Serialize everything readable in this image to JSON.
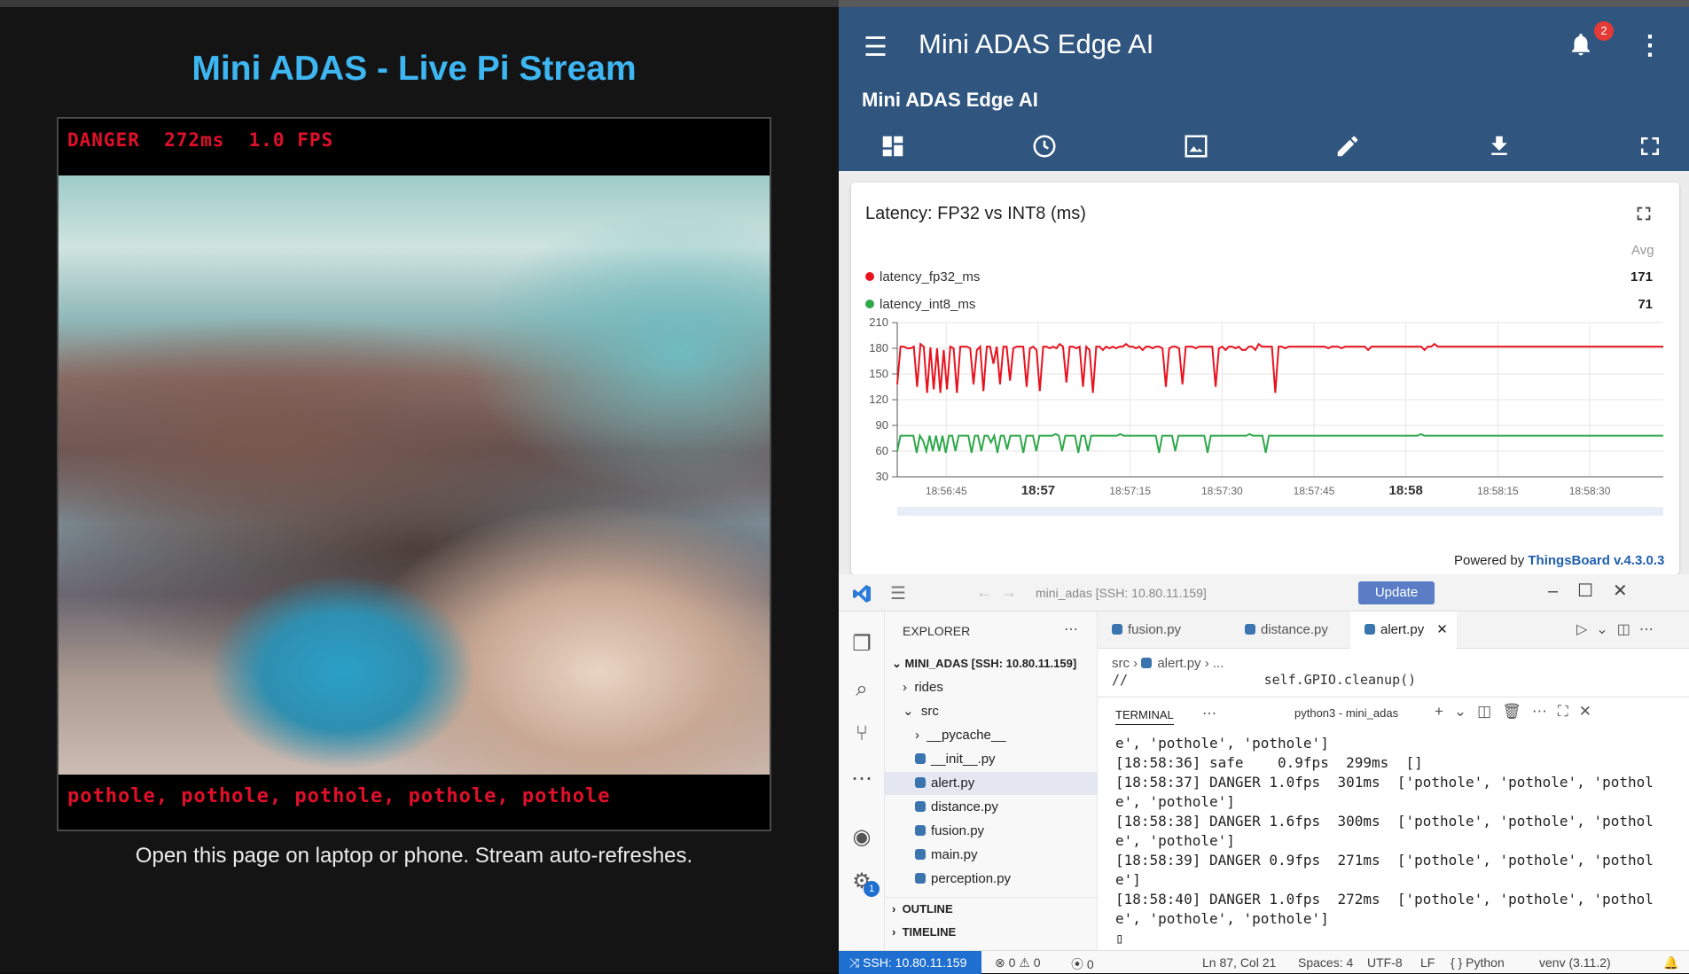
{
  "stream": {
    "title": "Mini ADAS - Live Pi Stream",
    "overlay_status": "DANGER  272ms  1.0 FPS",
    "overlay_labels": "pothole, pothole, pothole, pothole, pothole",
    "caption": "Open this page on laptop or phone. Stream auto-refreshes."
  },
  "thingsboard": {
    "app_title": "Mini ADAS Edge AI",
    "notification_count": "2",
    "dashboard_title": "Mini ADAS Edge AI",
    "toolbar_icons": [
      "dashboard-icon",
      "clock-icon",
      "image-icon",
      "edit-icon",
      "download-icon",
      "fullscreen-icon"
    ],
    "widget": {
      "title": "Latency: FP32 vs INT8 (ms)",
      "avg_label": "Avg",
      "legend": [
        {
          "name": "latency_fp32_ms",
          "avg": "171",
          "color": "#e8131f"
        },
        {
          "name": "latency_int8_ms",
          "avg": "71",
          "color": "#2fa84a"
        }
      ],
      "powered_prefix": "Powered by",
      "powered_link": "ThingsBoard v.4.3.0.3"
    }
  },
  "chart_data": {
    "type": "line",
    "title": "Latency: FP32 vs INT8 (ms)",
    "xlabel": "",
    "ylabel": "",
    "ylim": [
      30,
      210
    ],
    "yticks": [
      30,
      60,
      90,
      120,
      150,
      180,
      210
    ],
    "xlim": [
      "18:56:37",
      "18:58:42"
    ],
    "xticks": [
      {
        "t": "18:56:45",
        "label": "18:56:45",
        "major": false
      },
      {
        "t": "18:57:00",
        "label": "18:57",
        "major": true
      },
      {
        "t": "18:57:15",
        "label": "18:57:15",
        "major": false
      },
      {
        "t": "18:57:30",
        "label": "18:57:30",
        "major": false
      },
      {
        "t": "18:57:45",
        "label": "18:57:45",
        "major": false
      },
      {
        "t": "18:58:00",
        "label": "18:58",
        "major": true
      },
      {
        "t": "18:58:15",
        "label": "18:58:15",
        "major": false
      },
      {
        "t": "18:58:30",
        "label": "18:58:30",
        "major": false
      }
    ],
    "grid": true,
    "series": [
      {
        "name": "latency_fp32_ms",
        "color": "#e8131f",
        "values": [
          138,
          182,
          182,
          180,
          180,
          182,
          135,
          185,
          182,
          128,
          181,
          132,
          180,
          128,
          178,
          132,
          182,
          180,
          128,
          182,
          182,
          182,
          180,
          138,
          178,
          182,
          130,
          182,
          182,
          162,
          182,
          138,
          182,
          182,
          142,
          180,
          182,
          182,
          182,
          135,
          180,
          182,
          178,
          130,
          182,
          182,
          180,
          182,
          180,
          185,
          182,
          140,
          182,
          182,
          180,
          182,
          135,
          182,
          178,
          128,
          182,
          182,
          178,
          182,
          180,
          182,
          180,
          182,
          182,
          185,
          182,
          182,
          180,
          182,
          178,
          182,
          182,
          180,
          182,
          182,
          180,
          135,
          180,
          182,
          182,
          180,
          138,
          182,
          182,
          182,
          180,
          182,
          182,
          182,
          182,
          182,
          135,
          180,
          182,
          178,
          182,
          182,
          180,
          182,
          178,
          178,
          182,
          182,
          178,
          185,
          182,
          182,
          182,
          182,
          128,
          182,
          182,
          180,
          182,
          182,
          182,
          182,
          182,
          182,
          182,
          182,
          182,
          182,
          182,
          182,
          180,
          182,
          182,
          182,
          180,
          182,
          182,
          182,
          182,
          182,
          182,
          182,
          178,
          182,
          182,
          182,
          182,
          182,
          182,
          182,
          182,
          182,
          182,
          182,
          182,
          182,
          182,
          182,
          182,
          178,
          182,
          182,
          185,
          182,
          182,
          182,
          182,
          182,
          182,
          182,
          182,
          182,
          182,
          182,
          182,
          182,
          182,
          182,
          182,
          182,
          182,
          182,
          182,
          182,
          182,
          182,
          182,
          182,
          182,
          182,
          182,
          182,
          182,
          182,
          182,
          182,
          182,
          182,
          182,
          182,
          182,
          182,
          182,
          182,
          182,
          182,
          182,
          182,
          182,
          182,
          182,
          182,
          182,
          182,
          182,
          182,
          182,
          182,
          182,
          182,
          182,
          182,
          182,
          182,
          182,
          182,
          182,
          182,
          182,
          182,
          182,
          182
        ]
      },
      {
        "name": "latency_int8_ms",
        "color": "#2fa84a",
        "values": [
          60,
          78,
          78,
          78,
          78,
          78,
          58,
          78,
          72,
          60,
          78,
          60,
          78,
          60,
          78,
          58,
          78,
          78,
          60,
          78,
          78,
          78,
          78,
          58,
          78,
          78,
          60,
          78,
          78,
          70,
          78,
          58,
          78,
          78,
          62,
          78,
          78,
          78,
          78,
          58,
          78,
          78,
          78,
          60,
          78,
          78,
          78,
          78,
          78,
          80,
          78,
          60,
          78,
          78,
          78,
          78,
          58,
          78,
          78,
          60,
          78,
          78,
          78,
          78,
          78,
          78,
          78,
          78,
          78,
          80,
          78,
          78,
          78,
          78,
          78,
          78,
          78,
          78,
          78,
          78,
          78,
          58,
          78,
          78,
          78,
          78,
          60,
          78,
          78,
          78,
          78,
          78,
          78,
          78,
          78,
          78,
          58,
          78,
          78,
          78,
          78,
          78,
          78,
          78,
          78,
          78,
          78,
          78,
          78,
          80,
          78,
          78,
          78,
          78,
          58,
          78,
          78,
          78,
          78,
          78,
          78,
          78,
          78,
          78,
          78,
          78,
          78,
          78,
          78,
          78,
          78,
          78,
          78,
          78,
          78,
          78,
          78,
          78,
          78,
          78,
          78,
          78,
          78,
          78,
          78,
          78,
          78,
          78,
          78,
          78,
          78,
          78,
          78,
          78,
          78,
          78,
          78,
          78,
          78,
          78,
          78,
          78,
          80,
          78,
          78,
          78,
          78,
          78,
          78,
          78,
          78,
          78,
          78,
          78,
          78,
          78,
          78,
          78,
          78,
          78,
          78,
          78,
          78,
          78,
          78,
          78,
          78,
          78,
          78,
          78,
          78,
          78,
          78,
          78,
          78,
          78,
          78,
          78,
          78,
          78,
          78,
          78,
          78,
          78,
          78,
          78,
          78,
          78,
          78,
          78,
          78,
          78,
          78,
          78,
          78,
          78,
          78,
          78,
          78,
          78,
          78,
          78,
          78,
          78,
          78,
          78,
          78,
          78,
          78,
          78,
          78,
          78,
          78,
          78,
          78,
          78,
          78,
          78
        ]
      }
    ]
  },
  "vscode": {
    "search": "mini_adas [SSH: 10.80.11.159]",
    "update_label": "Update",
    "explorer_title": "EXPLORER",
    "workspace": "MINI_ADAS [SSH: 10.80.11.159]",
    "tree": [
      {
        "label": "rides",
        "kind": "folder-closed"
      },
      {
        "label": "src",
        "kind": "folder-open"
      },
      {
        "label": "__pycache__",
        "kind": "folder-closed-child"
      },
      {
        "label": "__init__.py",
        "kind": "py"
      },
      {
        "label": "alert.py",
        "kind": "py",
        "selected": true
      },
      {
        "label": "distance.py",
        "kind": "py"
      },
      {
        "label": "fusion.py",
        "kind": "py"
      },
      {
        "label": "main.py",
        "kind": "py"
      },
      {
        "label": "perception.py",
        "kind": "py"
      }
    ],
    "outline_label": "OUTLINE",
    "timeline_label": "TIMELINE",
    "settings_badge": "1",
    "tabs": [
      "fusion.py",
      "distance.py",
      "alert.py"
    ],
    "breadcrumb_src": "src",
    "breadcrumb_file": "alert.py",
    "breadcrumb_more": "...",
    "code_visible": "//                 self.GPIO.cleanup()",
    "terminal_label": "TERMINAL",
    "terminal_shell": "python3 - mini_adas",
    "terminal_lines": [
      "e', 'pothole', 'pothole']",
      "[18:58:36] safe    0.9fps  299ms  []",
      "[18:58:37] DANGER 1.0fps  301ms  ['pothole', 'pothole', 'pothol",
      "e', 'pothole']",
      "[18:58:38] DANGER 1.6fps  300ms  ['pothole', 'pothole', 'pothol",
      "e', 'pothole']",
      "[18:58:39] DANGER 0.9fps  271ms  ['pothole', 'pothole', 'pothol",
      "e']",
      "[18:58:40] DANGER 1.0fps  272ms  ['pothole', 'pothole', 'pothol",
      "e', 'pothole', 'pothole']",
      "▯"
    ],
    "status": {
      "ssh": "SSH: 10.80.11.159",
      "errors": "0",
      "warnings": "0",
      "ports": "0",
      "position": "Ln 87, Col 21",
      "spaces": "Spaces: 4",
      "encoding": "UTF-8",
      "eol": "LF",
      "language": "Python",
      "venv": "venv (3.11.2)"
    }
  }
}
